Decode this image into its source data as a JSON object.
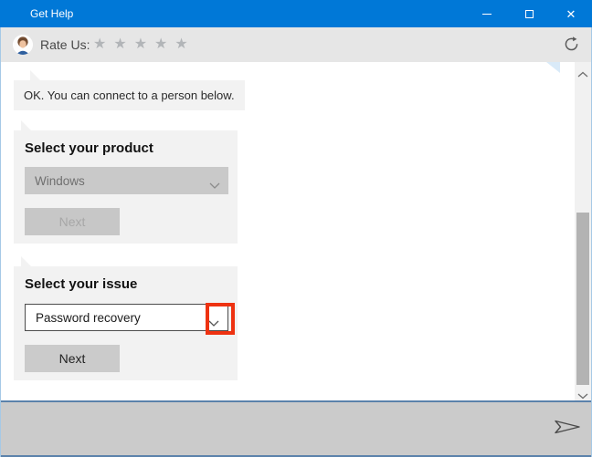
{
  "titlebar": {
    "title": "Get Help",
    "close_glyph": "✕"
  },
  "rate_bar": {
    "label": "Rate Us:",
    "star_glyph": "★",
    "stars_count": 5
  },
  "chat": {
    "bot_message": "OK. You can connect to a person below."
  },
  "cards": {
    "product": {
      "heading": "Select your product",
      "dropdown_value": "Windows",
      "next_label": "Next",
      "state": "disabled"
    },
    "issue": {
      "heading": "Select your issue",
      "dropdown_value": "Password recovery",
      "next_label": "Next",
      "state": "enabled"
    }
  },
  "annotation": {
    "shape": "red-rectangle",
    "highlights": "issue-dropdown-chevron",
    "color": "#ee3211"
  },
  "colors": {
    "titlebar_accent": "#0078d7",
    "ratebar_bg": "#e6e6e6",
    "card_bg": "#f2f2f2",
    "separator_blue": "#5b82ab",
    "annotation_red": "#ee3211"
  },
  "icons": {
    "avatar": "person-avatar",
    "refresh": "refresh-icon",
    "send": "send-icon",
    "dropdown": "chevron-down-icon",
    "scroll_up": "chevron-up-icon",
    "scroll_down": "chevron-down-icon"
  }
}
